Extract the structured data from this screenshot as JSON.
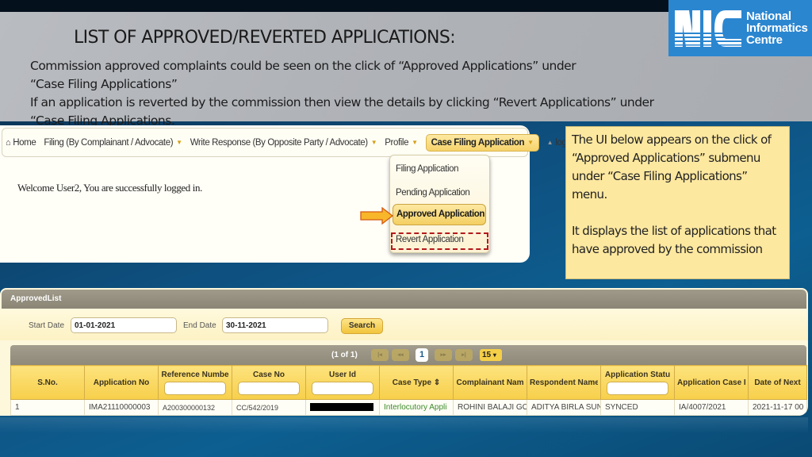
{
  "slide": {
    "title": "LIST OF APPROVED/REVERTED APPLICATIONS:",
    "description_lines": [
      "Commission approved complaints could be seen on the click of “Approved Applications” under",
      "“Case Filing Applications”",
      "If an application is reverted by the commission then view the details by clicking “Revert Applications” under",
      "“Case Filing Applications."
    ],
    "logo": {
      "abbr": "NIC",
      "line1": "National",
      "line2": "Informatics",
      "line3": "Centre",
      "color": "#2b86d0"
    }
  },
  "navbar": {
    "home": "Home",
    "filing": "Filing (By Complainant / Advocate)",
    "write_response": "Write Response (By Opposite Party / Advocate)",
    "profile": "Profile",
    "case_filing": "Case Filing Application",
    "logout": "logout"
  },
  "welcome_text": "Welcome User2, You are successfully logged in.",
  "dropdown": {
    "items": [
      "Filing Application",
      "Pending Application",
      "Approved Application",
      "Revert Application"
    ]
  },
  "callout": {
    "para1": "The UI below appears on the click of “Approved Applications” submenu under “Case Filing Applications” menu.",
    "para2": "It displays the list of applications that have approved by the commission"
  },
  "approved_list": {
    "panel_title": "ApprovedList",
    "start_date_label": "Start Date",
    "start_date": "01-01-2021",
    "end_date_label": "End Date",
    "end_date": "30-11-2021",
    "search_label": "Search",
    "pager": {
      "info": "(1 of 1)",
      "current_page": "1",
      "page_size": "15",
      "first": "|◂",
      "prev": "◂◂",
      "next": "▸▸",
      "last": "▸|"
    },
    "columns": [
      "S.No.",
      "Application No",
      "Reference Numbe",
      "Case No",
      "User Id",
      "Case Type ⇕",
      "Complainant Nam",
      "Respondent Name",
      "Application Statu",
      "Application Case I",
      "Date of Next"
    ],
    "rows": [
      [
        "1",
        "IMA21110000003",
        "A200300000132",
        "CC/542/2019",
        "",
        "Interlocutory Appli",
        "ROHINI BALAJI GO",
        "ADITYA BIRLA SUNI",
        "SYNCED",
        "IA/4007/2021",
        "2021-11-17 00"
      ]
    ]
  }
}
